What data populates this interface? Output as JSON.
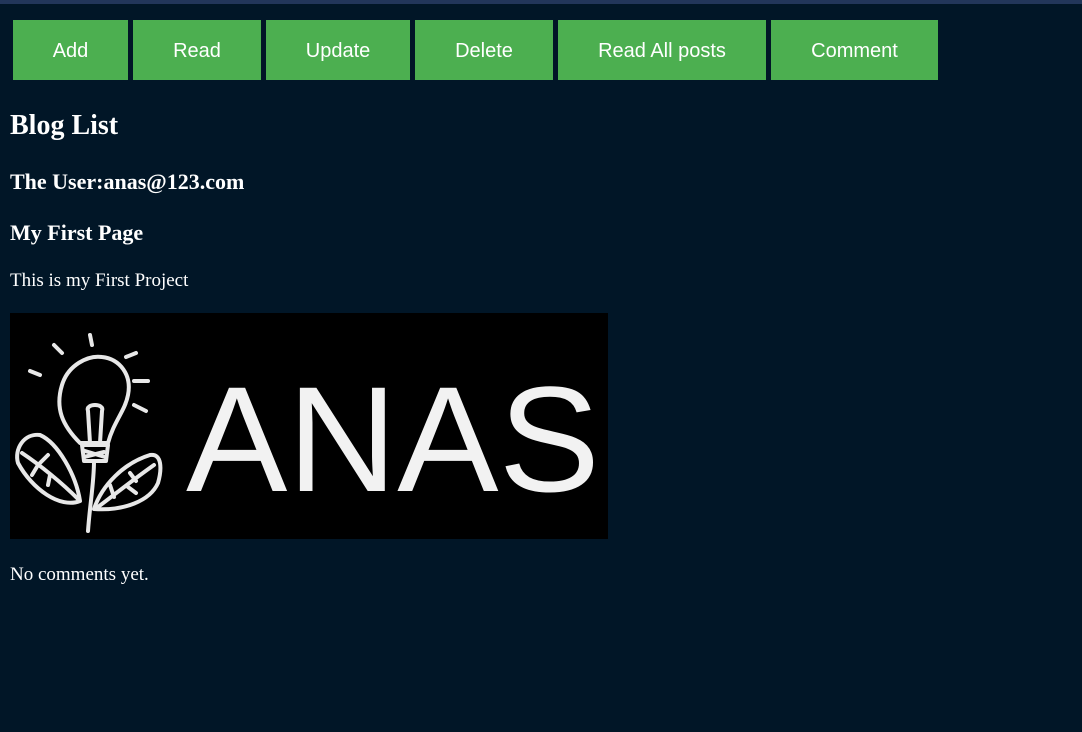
{
  "nav": {
    "buttons": [
      {
        "label": "Add"
      },
      {
        "label": "Read"
      },
      {
        "label": "Update"
      },
      {
        "label": "Delete"
      },
      {
        "label": "Read All posts"
      },
      {
        "label": "Comment"
      }
    ],
    "button_color": "#4caf50"
  },
  "page": {
    "heading": "Blog List",
    "user_line": "The User:anas@123.com",
    "background_color": "#011627"
  },
  "post": {
    "title": "My First Page",
    "body": "This is my First Project",
    "image": {
      "icon": "lightbulb-leaves-logo",
      "logo_text": "ANAS"
    }
  },
  "comments": {
    "empty_text": "No comments yet."
  }
}
